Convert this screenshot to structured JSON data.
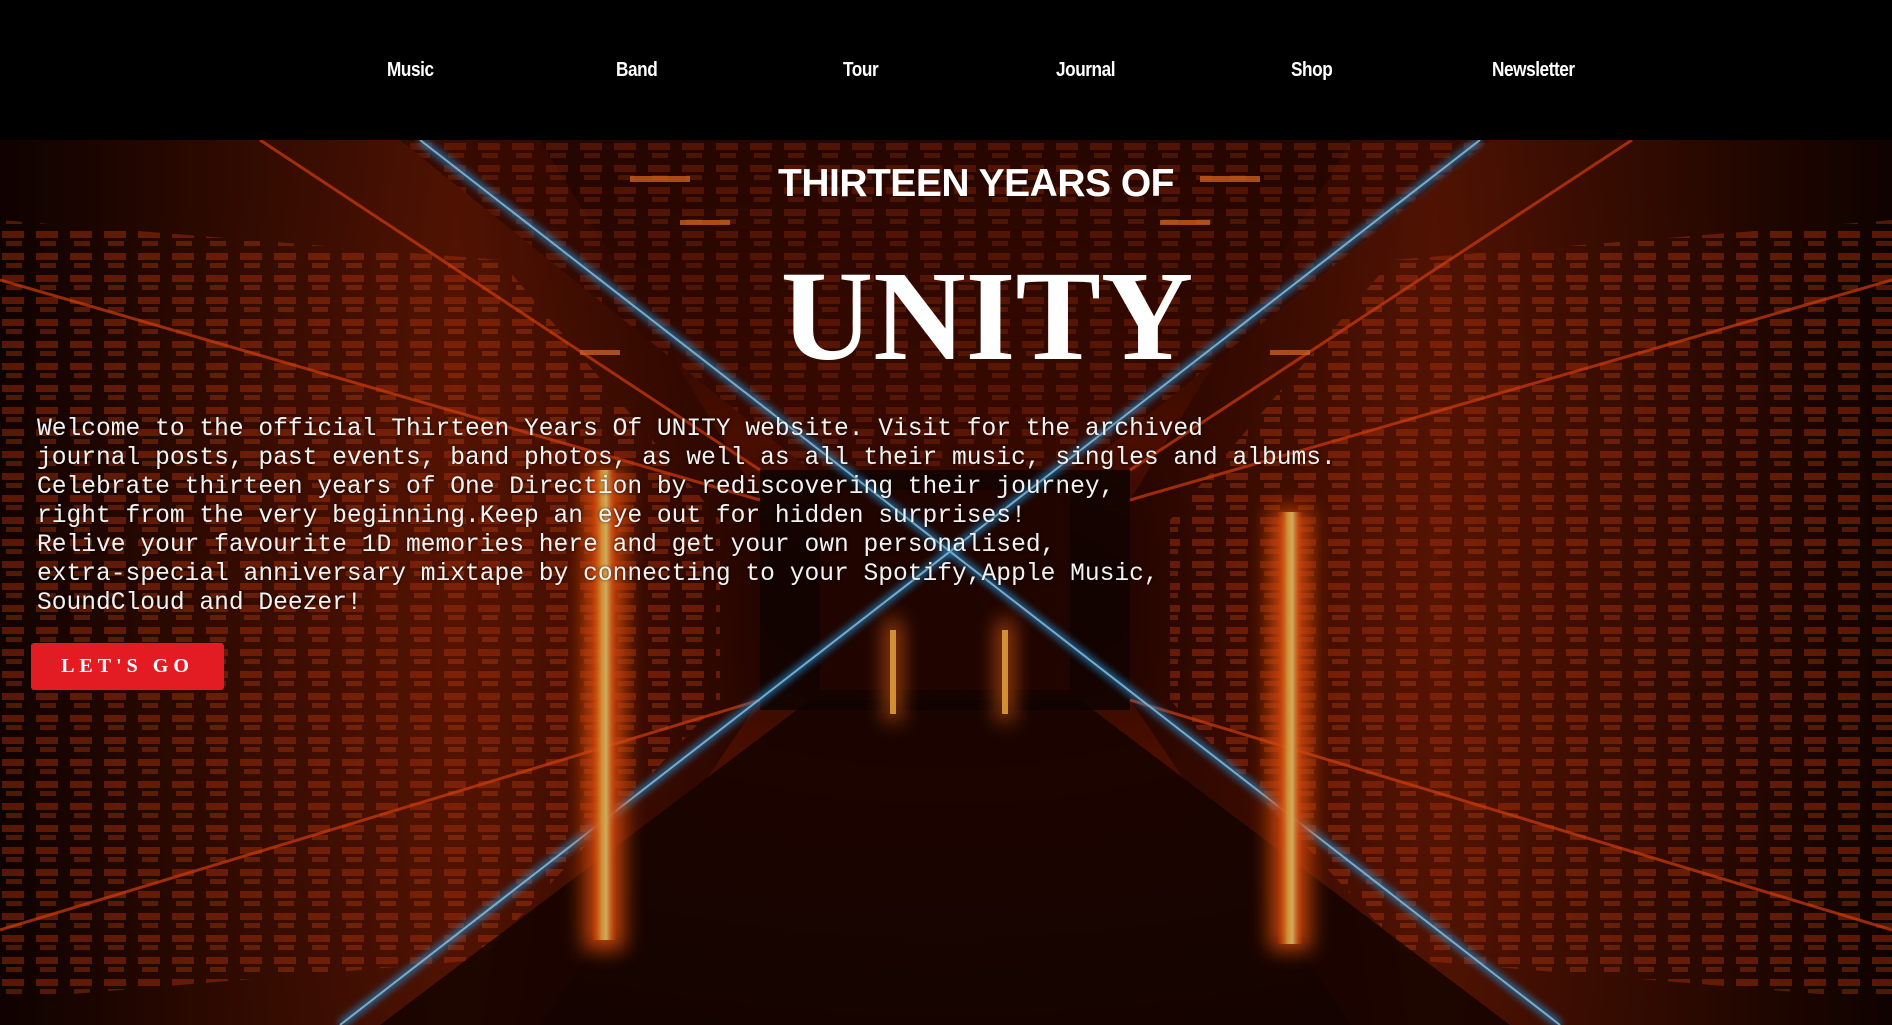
{
  "nav": {
    "items": [
      {
        "label": "Music"
      },
      {
        "label": "Band"
      },
      {
        "label": "Tour"
      },
      {
        "label": "Journal"
      },
      {
        "label": "Shop"
      },
      {
        "label": "Newsletter"
      }
    ]
  },
  "hero": {
    "subtitle": "THIRTEEN YEARS OF",
    "title": "UNITY",
    "intro_lines": [
      "Welcome to the official Thirteen Years Of UNITY website. Visit for the archived",
      "journal posts, past events, band photos, as well as all their music, singles and albums.",
      "Celebrate thirteen years of One Direction by rediscovering their journey,",
      "right from the very beginning.Keep an eye out for hidden surprises!",
      "Relive your favourite 1D memories here and get your own personalised,",
      "extra-special anniversary mixtape by connecting to your Spotify,Apple Music,",
      "SoundCloud and Deezer!"
    ],
    "cta_label": "LET'S GO",
    "background": "neon-tunnel-image"
  },
  "colors": {
    "nav_bg": "#000000",
    "accent": "#e31b23",
    "neon_orange": "#ff6a1a",
    "neon_blue": "#2aa8ff",
    "text": "#ffffff"
  }
}
